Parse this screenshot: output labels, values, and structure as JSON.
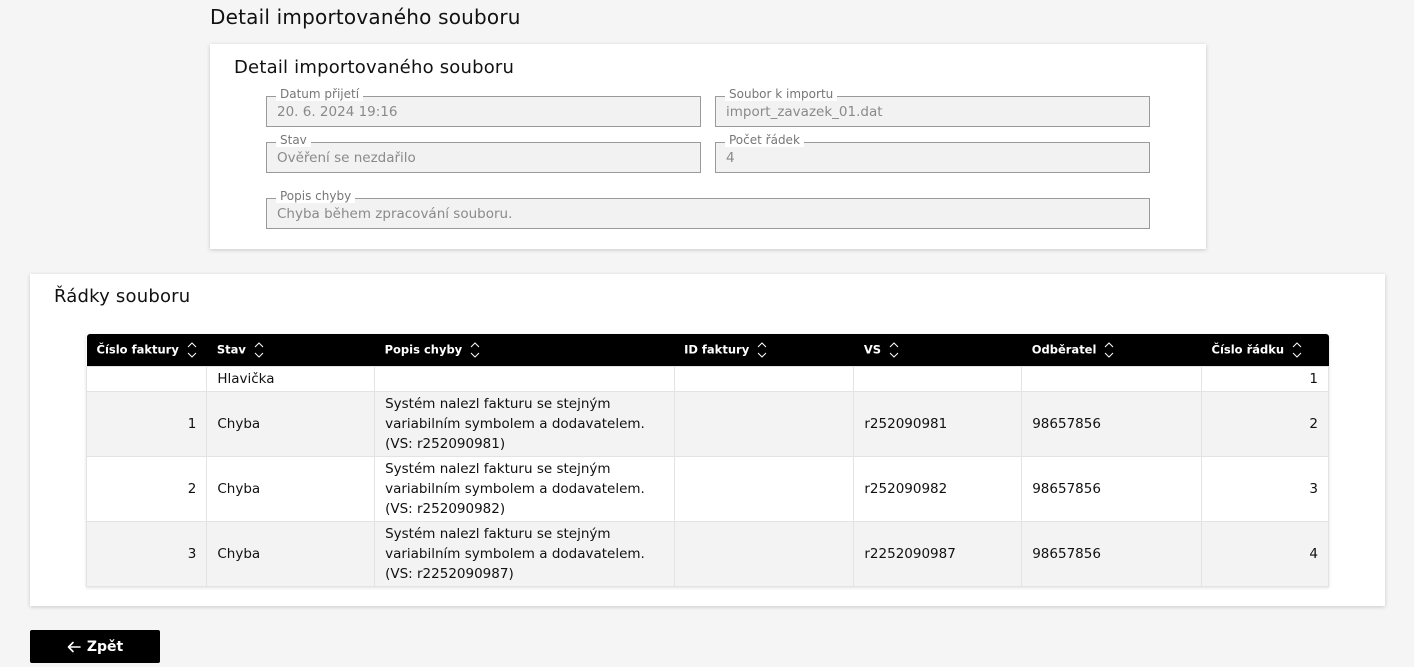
{
  "page": {
    "title": "Detail importovaného souboru"
  },
  "detail": {
    "title": "Detail importovaného souboru",
    "fields": {
      "datum_prijeti": {
        "label": "Datum přijetí",
        "value": "20. 6. 2024 19:16"
      },
      "soubor_k_importu": {
        "label": "Soubor k importu",
        "value": "import_zavazek_01.dat"
      },
      "stav": {
        "label": "Stav",
        "value": "Ověření se nezdařilo"
      },
      "pocet_radek": {
        "label": "Počet řádek",
        "value": "4"
      },
      "popis_chyby": {
        "label": "Popis chyby",
        "value": "Chyba během zpracování souboru."
      }
    }
  },
  "rows_section": {
    "title": "Řádky souboru",
    "columns": [
      "Číslo faktury",
      "Stav",
      "Popis chyby",
      "ID faktury",
      "VS",
      "Odběratel",
      "Číslo řádku"
    ],
    "rows": [
      {
        "cislo_faktury": "",
        "stav": "Hlavička",
        "popis_line1": "",
        "popis_line2": "",
        "popis_line3": "",
        "id_faktury": "",
        "vs": "",
        "odberatel": "",
        "cislo_radku": "1"
      },
      {
        "cislo_faktury": "1",
        "stav": "Chyba",
        "popis_line1": "Systém nalezl fakturu se stejným",
        "popis_line2": "variabilním symbolem a dodavatelem.",
        "popis_line3": "(VS: r252090981)",
        "id_faktury": "",
        "vs": "r252090981",
        "odberatel": "98657856",
        "cislo_radku": "2"
      },
      {
        "cislo_faktury": "2",
        "stav": "Chyba",
        "popis_line1": "Systém nalezl fakturu se stejným",
        "popis_line2": "variabilním symbolem a dodavatelem.",
        "popis_line3": "(VS: r252090982)",
        "id_faktury": "",
        "vs": "r252090982",
        "odberatel": "98657856",
        "cislo_radku": "3"
      },
      {
        "cislo_faktury": "3",
        "stav": "Chyba",
        "popis_line1": "Systém nalezl fakturu se stejným",
        "popis_line2": "variabilním symbolem a dodavatelem.",
        "popis_line3": "(VS: r2252090987)",
        "id_faktury": "",
        "vs": "r2252090987",
        "odberatel": "98657856",
        "cislo_radku": "4"
      }
    ]
  },
  "back_button": {
    "label": "Zpět",
    "icon": "arrow-left-icon"
  }
}
